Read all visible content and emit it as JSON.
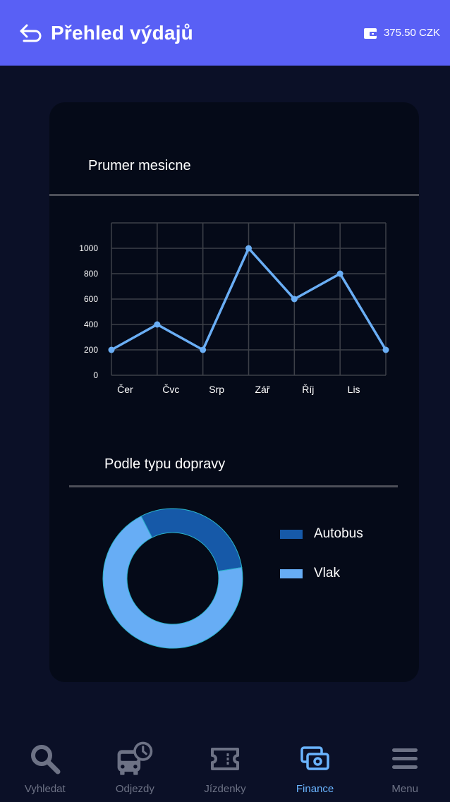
{
  "header": {
    "title": "Přehled výdajů",
    "wallet_amount": "375.50 CZK"
  },
  "card": {
    "line_section_title": "Prumer mesicne",
    "donut_section_title": "Podle typu dopravy"
  },
  "colors": {
    "header_bg": "#5960f5",
    "line": "#6aaef5",
    "bus": "#1659a8",
    "train": "#67adf5"
  },
  "chart_data": [
    {
      "type": "line",
      "categories": [
        "Čer",
        "Čvc",
        "Srp",
        "Zář",
        "Říj",
        "Lis"
      ],
      "x_indices": [
        0,
        1,
        2,
        3,
        4,
        5,
        6
      ],
      "values": [
        200,
        400,
        200,
        1000,
        600,
        800,
        200
      ],
      "y_ticks": [
        0,
        200,
        400,
        600,
        800,
        1000
      ],
      "ylim": [
        0,
        1200
      ],
      "grid": true
    },
    {
      "type": "pie",
      "labels": [
        "Autobus",
        "Vlak"
      ],
      "values": [
        30,
        70
      ],
      "donut": true,
      "legend": "right"
    }
  ],
  "nav": {
    "items": [
      {
        "label": "Vyhledat",
        "icon": "search-icon",
        "active": false
      },
      {
        "label": "Odjezdy",
        "icon": "bus-clock-icon",
        "active": false
      },
      {
        "label": "Jízdenky",
        "icon": "ticket-icon",
        "active": false
      },
      {
        "label": "Finance",
        "icon": "money-icon",
        "active": true
      },
      {
        "label": "Menu",
        "icon": "menu-icon",
        "active": false
      }
    ]
  }
}
